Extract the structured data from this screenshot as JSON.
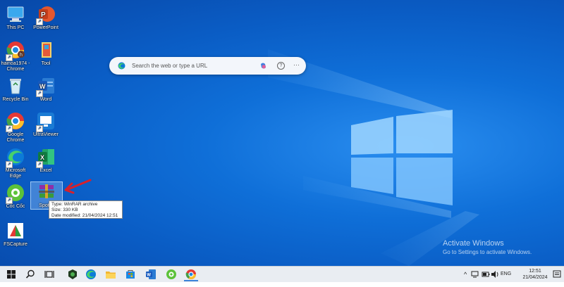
{
  "desktop": {
    "icons": [
      {
        "label": "This PC",
        "line2": ""
      },
      {
        "label": "PowerPoint",
        "line2": ""
      },
      {
        "label": "hainoa1974 -",
        "line2": "Chrome"
      },
      {
        "label": "Tool",
        "line2": ""
      },
      {
        "label": "Recycle Bin",
        "line2": ""
      },
      {
        "label": "Word",
        "line2": ""
      },
      {
        "label": "Google",
        "line2": "Chrome"
      },
      {
        "label": "UltraViewer",
        "line2": ""
      },
      {
        "label": "Microsoft",
        "line2": "Edge"
      },
      {
        "label": "Excel",
        "line2": ""
      },
      {
        "label": "Cốc Cốc",
        "line2": ""
      },
      {
        "label": "Spotify",
        "line2": ""
      },
      {
        "label": "FSCapture",
        "line2": ""
      }
    ]
  },
  "search": {
    "placeholder": "Search the web or type a URL",
    "help_glyph": "?",
    "more_glyph": "···"
  },
  "tooltip": {
    "type": "Type: WinRAR archive",
    "size": "Size: 330 KB",
    "modified": "Date modified: 21/04/2024 12:51"
  },
  "watermark": {
    "title": "Activate Windows",
    "subtitle": "Go to Settings to activate Windows."
  },
  "taskbar": {
    "language": "ENG",
    "time": "12:51",
    "date": "21/04/2024"
  },
  "colors": {
    "accent_arrow": "#d8202a",
    "taskbar_bg": "#e9edf2",
    "desktop_blue": "#0f6fd8"
  }
}
